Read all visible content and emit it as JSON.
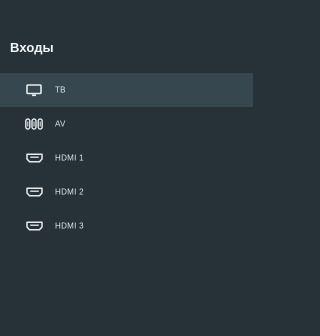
{
  "panel": {
    "title": "Входы"
  },
  "inputs": [
    {
      "label": "ТВ",
      "icon": "tv-icon",
      "selected": true
    },
    {
      "label": "AV",
      "icon": "av-connector-icon",
      "selected": false
    },
    {
      "label": "HDMI 1",
      "icon": "hdmi-icon",
      "selected": false
    },
    {
      "label": "HDMI 2",
      "icon": "hdmi-icon",
      "selected": false
    },
    {
      "label": "HDMI 3",
      "icon": "hdmi-icon",
      "selected": false
    }
  ],
  "colors": {
    "background": "#263238",
    "selected_row": "#37474f",
    "text": "#dfe4e7"
  }
}
